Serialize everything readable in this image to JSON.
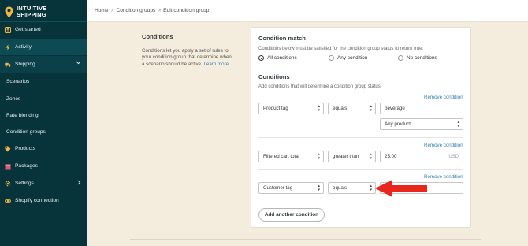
{
  "brand": {
    "name_line1": "INTUITIVE",
    "name_line2": "SHIPPING"
  },
  "sidebar": {
    "items": [
      {
        "label": "Get started",
        "icon": "upload-icon"
      },
      {
        "label": "Activity",
        "icon": "bolt-icon"
      },
      {
        "label": "Shipping",
        "icon": "truck-icon"
      },
      {
        "label": "Scenarios"
      },
      {
        "label": "Zones"
      },
      {
        "label": "Rate blending"
      },
      {
        "label": "Condition groups"
      },
      {
        "label": "Products",
        "icon": "tag-icon"
      },
      {
        "label": "Packages",
        "icon": "box-icon"
      },
      {
        "label": "Settings",
        "icon": "gear-icon"
      },
      {
        "label": "Shopify connection",
        "icon": "link-icon"
      }
    ]
  },
  "breadcrumb": {
    "home": "Home",
    "groups": "Condition groups",
    "current": "Edit condition group"
  },
  "intro": {
    "title": "Conditions",
    "text": "Conditions let you apply a set of rules to your condition group that determine when a scenario should be active.",
    "link": "Learn more."
  },
  "match": {
    "title": "Condition match",
    "help": "Conditions below must be satisfied for the condition group status to return true.",
    "options": [
      "All conditions",
      "Any condition",
      "No conditions"
    ],
    "selected": "All conditions"
  },
  "conditions": {
    "title": "Conditions",
    "help": "Add conditions that will determine a condition group status.",
    "remove_label": "Remove condition",
    "rows": [
      {
        "field": "Product tag",
        "operator": "equals",
        "value": "beverage",
        "extra": "Any product"
      },
      {
        "field": "Filtered cart total",
        "operator": "greater than",
        "value": "25.00",
        "unit": "USD"
      },
      {
        "field": "Customer tag",
        "operator": "equals",
        "value": ""
      }
    ],
    "add_label": "Add another condition"
  },
  "colors": {
    "sidebar": "#07333a",
    "accent": "#f2b544",
    "link": "#2f7fb8",
    "arrow": "#e8261e"
  }
}
